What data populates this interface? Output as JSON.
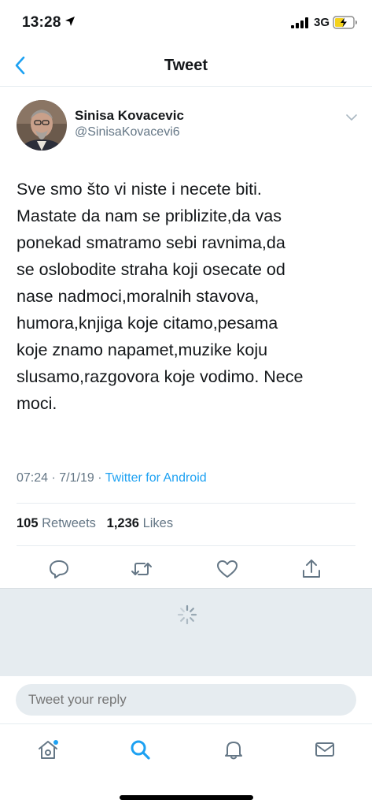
{
  "status_bar": {
    "time": "13:28",
    "network": "3G",
    "icons": [
      "location-arrow-icon",
      "cellular-signal-icon",
      "battery-charging-icon"
    ]
  },
  "nav": {
    "title": "Tweet",
    "back_icon": "chevron-left-icon"
  },
  "tweet": {
    "author_name": "Sinisa Kovacevic",
    "author_handle": "@SinisaKovacevi6",
    "text_lines": [
      "Sve smo što vi niste i necete biti.",
      "Mastate da nam se priblizite,da vas",
      "ponekad smatramo sebi ravnima,da",
      "se oslobodite straha koji osecate od",
      "nase nadmoci,moralnih stavova,",
      "humora,knjiga koje citamo,pesama",
      "koje znamo napamet,muzike koju",
      "slusamo,razgovora koje vodimo. Nece",
      "moci."
    ],
    "time": "07:24",
    "date": "7/1/19",
    "separator": "·",
    "source": "Twitter for Android",
    "retweets_count": "105",
    "retweets_label": "Retweets",
    "likes_count": "1,236",
    "likes_label": "Likes"
  },
  "actions": [
    "reply-icon",
    "retweet-icon",
    "like-icon",
    "share-icon"
  ],
  "reply": {
    "placeholder": "Tweet your reply"
  },
  "tab_bar": [
    "home-icon",
    "search-icon",
    "notifications-icon",
    "messages-icon"
  ],
  "colors": {
    "accent": "#1da1f2",
    "secondary_text": "#657786",
    "divider": "#e6ecf0",
    "gray_area": "#e6ecf0"
  }
}
